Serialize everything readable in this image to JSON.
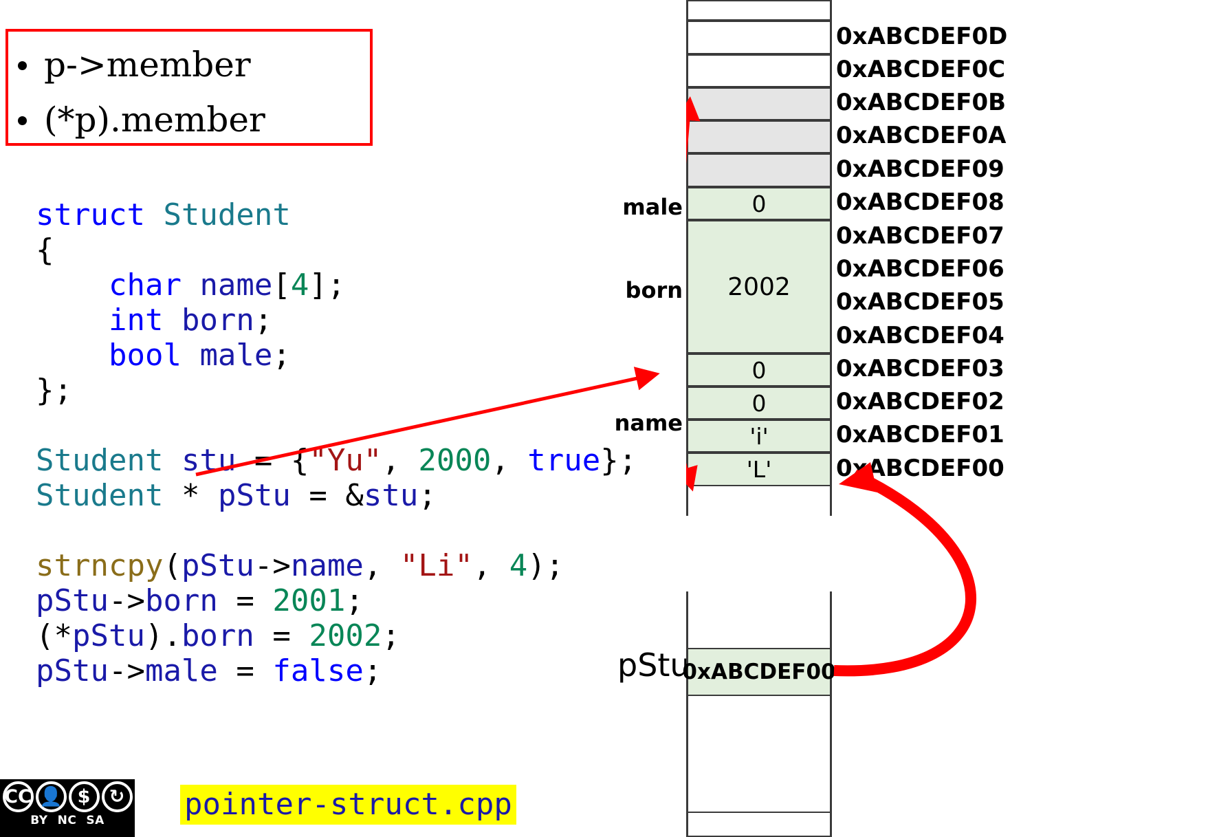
{
  "syntax_box": {
    "items": [
      "p->member",
      "(*p).member"
    ],
    "border_color": "#ff0000"
  },
  "code": {
    "lines": [
      [
        {
          "t": "struct ",
          "c": "kw"
        },
        {
          "t": "Student",
          "c": "typ"
        }
      ],
      [
        {
          "t": "{",
          "c": "pl"
        }
      ],
      [
        {
          "t": "    ",
          "c": "pl"
        },
        {
          "t": "char",
          "c": "kw"
        },
        {
          "t": " ",
          "c": "pl"
        },
        {
          "t": "name",
          "c": "var"
        },
        {
          "t": "[",
          "c": "pl"
        },
        {
          "t": "4",
          "c": "num"
        },
        {
          "t": "];",
          "c": "pl"
        }
      ],
      [
        {
          "t": "    ",
          "c": "pl"
        },
        {
          "t": "int",
          "c": "kw"
        },
        {
          "t": " ",
          "c": "pl"
        },
        {
          "t": "born",
          "c": "var"
        },
        {
          "t": ";",
          "c": "pl"
        }
      ],
      [
        {
          "t": "    ",
          "c": "pl"
        },
        {
          "t": "bool",
          "c": "kw"
        },
        {
          "t": " ",
          "c": "pl"
        },
        {
          "t": "male",
          "c": "var"
        },
        {
          "t": ";",
          "c": "pl"
        }
      ],
      [
        {
          "t": "};",
          "c": "pl"
        }
      ],
      [
        {
          "t": " ",
          "c": "pl"
        }
      ],
      [
        {
          "t": "Student",
          "c": "typ"
        },
        {
          "t": " ",
          "c": "pl"
        },
        {
          "t": "stu",
          "c": "var"
        },
        {
          "t": " = {",
          "c": "pl"
        },
        {
          "t": "\"Yu\"",
          "c": "str"
        },
        {
          "t": ", ",
          "c": "pl"
        },
        {
          "t": "2000",
          "c": "num"
        },
        {
          "t": ", ",
          "c": "pl"
        },
        {
          "t": "true",
          "c": "kw"
        },
        {
          "t": "};",
          "c": "pl"
        }
      ],
      [
        {
          "t": "Student",
          "c": "typ"
        },
        {
          "t": " ",
          "c": "pl"
        },
        {
          "t": "*",
          "c": "pl"
        },
        {
          "t": " ",
          "c": "pl"
        },
        {
          "t": "pStu",
          "c": "var"
        },
        {
          "t": " = &",
          "c": "pl"
        },
        {
          "t": "stu",
          "c": "var"
        },
        {
          "t": ";",
          "c": "pl"
        }
      ],
      [
        {
          "t": " ",
          "c": "pl"
        }
      ],
      [
        {
          "t": "strncpy",
          "c": "fn"
        },
        {
          "t": "(",
          "c": "pl"
        },
        {
          "t": "pStu",
          "c": "var"
        },
        {
          "t": "->",
          "c": "pl"
        },
        {
          "t": "name",
          "c": "var"
        },
        {
          "t": ", ",
          "c": "pl"
        },
        {
          "t": "\"Li\"",
          "c": "str"
        },
        {
          "t": ", ",
          "c": "pl"
        },
        {
          "t": "4",
          "c": "num"
        },
        {
          "t": ");",
          "c": "pl"
        }
      ],
      [
        {
          "t": "pStu",
          "c": "var"
        },
        {
          "t": "->",
          "c": "pl"
        },
        {
          "t": "born",
          "c": "var"
        },
        {
          "t": " = ",
          "c": "pl"
        },
        {
          "t": "2001",
          "c": "num"
        },
        {
          "t": ";",
          "c": "pl"
        }
      ],
      [
        {
          "t": "(*",
          "c": "pl"
        },
        {
          "t": "pStu",
          "c": "var"
        },
        {
          "t": ").",
          "c": "pl"
        },
        {
          "t": "born",
          "c": "var"
        },
        {
          "t": " = ",
          "c": "pl"
        },
        {
          "t": "2002",
          "c": "num"
        },
        {
          "t": ";",
          "c": "pl"
        }
      ],
      [
        {
          "t": "pStu",
          "c": "var"
        },
        {
          "t": "->",
          "c": "pl"
        },
        {
          "t": "male",
          "c": "var"
        },
        {
          "t": " = ",
          "c": "pl"
        },
        {
          "t": "false",
          "c": "kw"
        },
        {
          "t": ";",
          "c": "pl"
        }
      ]
    ],
    "colors": {
      "keyword": "#0000ff",
      "type": "#1a7a8c",
      "number": "#098657",
      "string": "#a31515",
      "function": "#8a6d1a",
      "variable": "#1a1aa8",
      "plain": "#000000"
    }
  },
  "file_name": "pointer-struct.cpp",
  "file_name_highlight": "#ffff00",
  "license": {
    "icons": [
      "cc-icon",
      "by-person-icon",
      "nc-nocommercial-icon",
      "sa-sharealike-icon"
    ],
    "glyphs": [
      "Ⓒ",
      "ⓘ",
      "ⓢ",
      "ⓢ"
    ],
    "labels": [
      "BY",
      "NC",
      "SA"
    ]
  },
  "memory": {
    "cells": [
      {
        "value": "",
        "address": "",
        "fill": "white",
        "tall": false
      },
      {
        "value": "",
        "address": "0xABCDEF0D",
        "fill": "white",
        "tall": false
      },
      {
        "value": "",
        "address": "0xABCDEF0C",
        "fill": "white",
        "tall": false
      },
      {
        "value": "",
        "address": "0xABCDEF0B",
        "fill": "gray",
        "tall": false
      },
      {
        "value": "",
        "address": "0xABCDEF0A",
        "fill": "gray",
        "tall": false
      },
      {
        "value": "",
        "address": "0xABCDEF09",
        "fill": "gray",
        "tall": false
      },
      {
        "value": "0",
        "address": "0xABCDEF08",
        "fill": "green",
        "tall": false
      },
      {
        "value": "2002",
        "address": "0xABCDEF07",
        "fill": "green",
        "tall": true
      },
      {
        "value": "",
        "address": "0xABCDEF06",
        "fill": "green",
        "tall": false
      },
      {
        "value": "",
        "address": "0xABCDEF05",
        "fill": "green",
        "tall": false
      },
      {
        "value": "",
        "address": "0xABCDEF04",
        "fill": "green",
        "tall": false
      },
      {
        "value": "0",
        "address": "0xABCDEF03",
        "fill": "green",
        "tall": false
      },
      {
        "value": "0",
        "address": "0xABCDEF02",
        "fill": "green",
        "tall": false
      },
      {
        "value": "'i'",
        "address": "0xABCDEF01",
        "fill": "green",
        "tall": false
      },
      {
        "value": "'L'",
        "address": "0xABCDEF00",
        "fill": "green",
        "tall": false
      }
    ],
    "field_labels": {
      "male": "male",
      "born": "born",
      "name": "name"
    },
    "pointer_var": {
      "label": "pStu",
      "value": "0xABCDEF00"
    },
    "arrow_color": "#ff0000",
    "cell_fills": {
      "white": "#ffffff",
      "gray": "#e5e5e5",
      "green": "#e2efdd"
    }
  }
}
